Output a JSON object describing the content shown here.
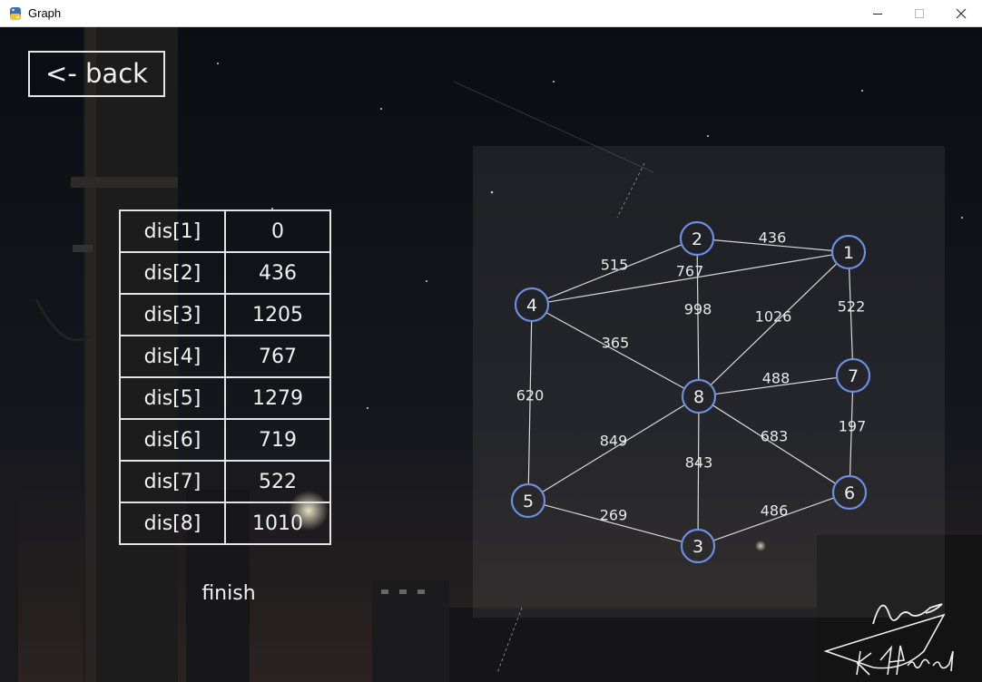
{
  "window": {
    "title": "Graph"
  },
  "back_button": {
    "label": "<- back"
  },
  "distances": [
    {
      "label": "dis[1]",
      "value": "0"
    },
    {
      "label": "dis[2]",
      "value": "436"
    },
    {
      "label": "dis[3]",
      "value": "1205"
    },
    {
      "label": "dis[4]",
      "value": "767"
    },
    {
      "label": "dis[5]",
      "value": "1279"
    },
    {
      "label": "dis[6]",
      "value": "719"
    },
    {
      "label": "dis[7]",
      "value": "522"
    },
    {
      "label": "dis[8]",
      "value": "1010"
    }
  ],
  "status": "finish",
  "graph": {
    "node_color": "#6d8fe0",
    "nodes": [
      {
        "id": "1",
        "label": "1"
      },
      {
        "id": "2",
        "label": "2"
      },
      {
        "id": "3",
        "label": "3"
      },
      {
        "id": "4",
        "label": "4"
      },
      {
        "id": "5",
        "label": "5"
      },
      {
        "id": "6",
        "label": "6"
      },
      {
        "id": "7",
        "label": "7"
      },
      {
        "id": "8",
        "label": "8"
      }
    ],
    "edges": [
      {
        "from": "2",
        "to": "1",
        "weight": "436"
      },
      {
        "from": "2",
        "to": "4",
        "weight": "515"
      },
      {
        "from": "1",
        "to": "4",
        "weight": "767"
      },
      {
        "from": "2",
        "to": "8",
        "weight": "998"
      },
      {
        "from": "1",
        "to": "8",
        "weight": "1026"
      },
      {
        "from": "1",
        "to": "7",
        "weight": "522"
      },
      {
        "from": "4",
        "to": "8",
        "weight": "365"
      },
      {
        "from": "8",
        "to": "7",
        "weight": "488"
      },
      {
        "from": "4",
        "to": "5",
        "weight": "620"
      },
      {
        "from": "5",
        "to": "8",
        "weight": "849"
      },
      {
        "from": "8",
        "to": "6",
        "weight": "683"
      },
      {
        "from": "7",
        "to": "6",
        "weight": "197"
      },
      {
        "from": "8",
        "to": "3",
        "weight": "843"
      },
      {
        "from": "5",
        "to": "3",
        "weight": "269"
      },
      {
        "from": "3",
        "to": "6",
        "weight": "486"
      }
    ]
  },
  "signature": {
    "text": "An. K. Hanada"
  }
}
